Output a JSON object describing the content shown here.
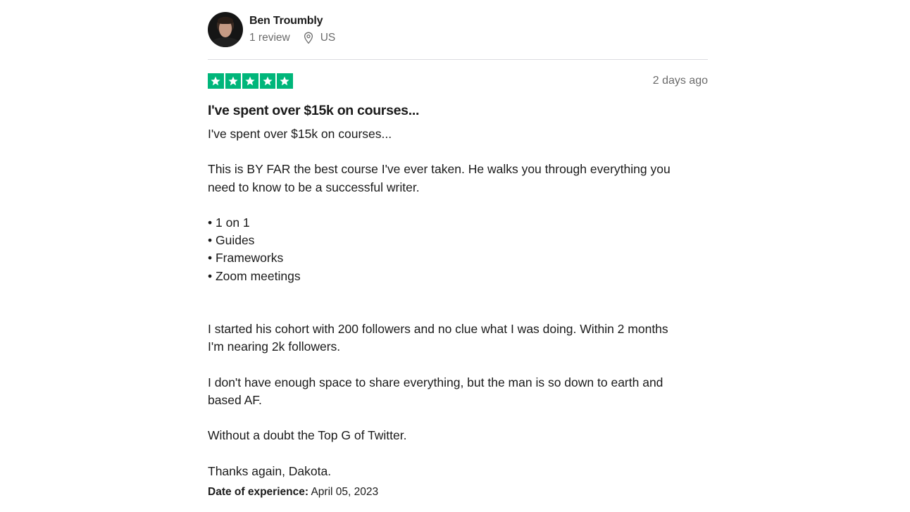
{
  "reviewer": {
    "name": "Ben Troumbly",
    "review_count": "1 review",
    "country": "US"
  },
  "rating": {
    "stars": 5,
    "max_stars": 5,
    "star_color": "#00b67a"
  },
  "date_ago": "2 days ago",
  "review": {
    "title": "I've spent over $15k on courses...",
    "intro": "I've spent over $15k on courses...",
    "para1_line1": "This is BY FAR the best course I've ever taken. He walks you through everything you",
    "para1_line2": "need to know to be a successful writer.",
    "bullets": [
      "• 1 on 1",
      "• Guides",
      "• Frameworks",
      "• Zoom meetings"
    ],
    "para2_line1": "I started his cohort with 200 followers and no clue what I was doing. Within 2 months",
    "para2_line2": "I'm nearing 2k followers.",
    "para3_line1": "I don't have enough space to share everything, but the man is so down to earth and",
    "para3_line2": "based AF.",
    "para4": "Without a doubt the Top G of Twitter.",
    "para5": "Thanks again, Dakota."
  },
  "experience": {
    "label": "Date of experience:",
    "date": "April 05, 2023"
  },
  "icons": {
    "location": "location-pin-icon",
    "star": "star-icon"
  }
}
